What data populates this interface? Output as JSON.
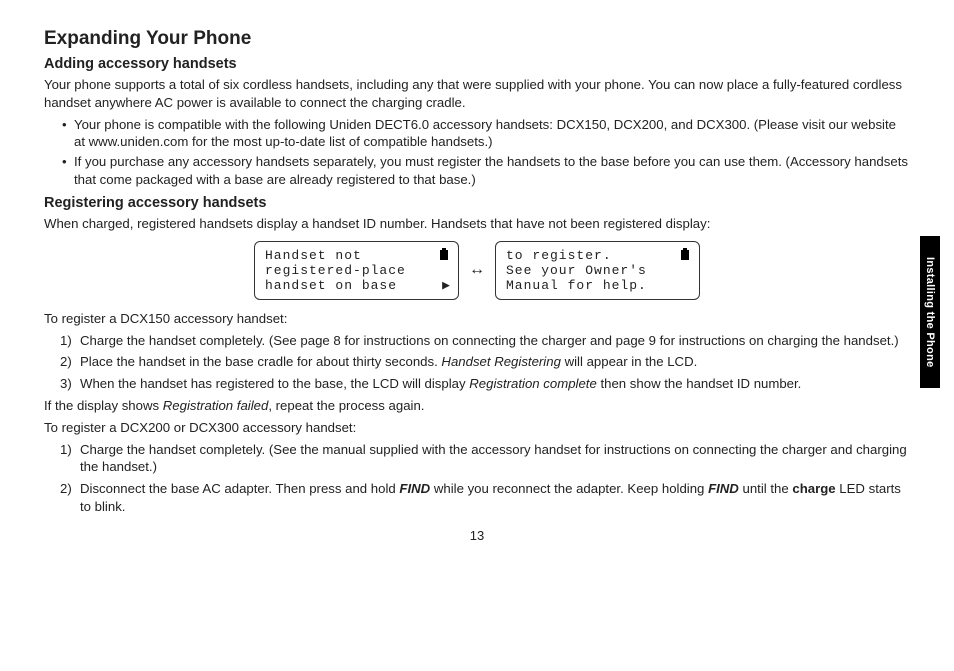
{
  "title": "Expanding Your Phone",
  "sections": {
    "adding": {
      "heading": "Adding accessory handsets",
      "intro": "Your phone supports a total of six cordless handsets, including any that were supplied with your phone. You can now place a fully-featured cordless handset anywhere AC power is available to connect the charging cradle.",
      "bullets": [
        "Your phone is compatible with the following Uniden DECT6.0 accessory handsets: DCX150, DCX200, and DCX300. (Please visit our website at www.uniden.com for the most up-to-date list of compatible handsets.)",
        "If you purchase any accessory handsets separately, you must register the handsets to the base before you can use them. (Accessory handsets that come packaged with a base are already registered to that base.)"
      ]
    },
    "registering": {
      "heading": "Registering accessory handsets",
      "intro": "When charged, registered handsets display a handset ID number. Handsets that have not been registered display:",
      "lcd": {
        "left": {
          "l1": "Handset not",
          "l2": "registered-place",
          "l3": "handset on base"
        },
        "right": {
          "l1": "to register.",
          "l2": "See your Owner's",
          "l3": "Manual for help."
        }
      },
      "dcx150": {
        "lead": "To register a DCX150 accessory handset:",
        "steps": [
          "Charge the handset completely. (See page 8 for instructions on connecting the charger and page 9 for instructions on charging the handset.)"
        ],
        "step2_pre": "Place the handset in the base cradle for about thirty seconds. ",
        "step2_italic": "Handset Registering",
        "step2_post": " will appear in the LCD.",
        "step3_pre": "When the handset has registered to the base, the LCD will display ",
        "step3_italic": "Registration complete",
        "step3_post": " then show the handset ID number.",
        "fail_pre": "If the display shows ",
        "fail_italic": "Registration failed",
        "fail_post": ", repeat the process again."
      },
      "dcx200": {
        "lead": "To register a DCX200 or DCX300 accessory handset:",
        "step1": "Charge the handset completely. (See the manual supplied with the accessory handset for instructions on connecting the charger and charging the handset.)",
        "step2_a": "Disconnect the base AC adapter. Then press and hold ",
        "step2_find": "FIND",
        "step2_b": " while you reconnect the adapter. Keep holding ",
        "step2_c": " until the ",
        "step2_charge": "charge",
        "step2_d": " LED starts to blink."
      }
    }
  },
  "sideTab": "Installing the Phone",
  "pageNumber": "13",
  "arrowSymbol": "↔",
  "rightTriangle": "▶"
}
